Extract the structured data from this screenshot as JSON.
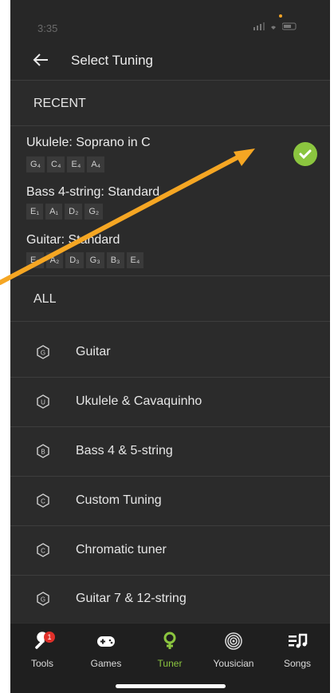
{
  "status_bar": {
    "time": "3:35"
  },
  "header": {
    "title": "Select Tuning",
    "back_icon": "arrow-left-icon"
  },
  "recent": {
    "heading": "RECENT",
    "items": [
      {
        "name": "Ukulele: Soprano in C",
        "notes": [
          "G₄",
          "C₄",
          "E₄",
          "A₄"
        ],
        "selected": true
      },
      {
        "name": "Bass 4-string: Standard",
        "notes": [
          "E₁",
          "A₁",
          "D₂",
          "G₂"
        ],
        "selected": false
      },
      {
        "name": "Guitar: Standard",
        "notes": [
          "E₂",
          "A₂",
          "D₃",
          "G₃",
          "B₃",
          "E₄"
        ],
        "selected": false
      }
    ]
  },
  "all": {
    "heading": "ALL",
    "items": [
      {
        "label": "Guitar",
        "icon_letter": "G"
      },
      {
        "label": "Ukulele & Cavaquinho",
        "icon_letter": "U"
      },
      {
        "label": "Bass 4 & 5-string",
        "icon_letter": "B"
      },
      {
        "label": "Custom Tuning",
        "icon_letter": "C"
      },
      {
        "label": "Chromatic tuner",
        "icon_letter": "C"
      },
      {
        "label": "Guitar 7 & 12-string",
        "icon_letter": "G"
      }
    ]
  },
  "tabs": [
    {
      "label": "Tools",
      "icon": "wrench-icon",
      "badge": "1"
    },
    {
      "label": "Games",
      "icon": "gamepad-icon"
    },
    {
      "label": "Tuner",
      "icon": "tuner-pin-icon",
      "active": true
    },
    {
      "label": "Yousician",
      "icon": "fingerprint-icon"
    },
    {
      "label": "Songs",
      "icon": "songs-icon"
    }
  ],
  "colors": {
    "accent": "#8bc53f",
    "annotation_arrow": "#f5a623",
    "badge": "#e0302a"
  }
}
